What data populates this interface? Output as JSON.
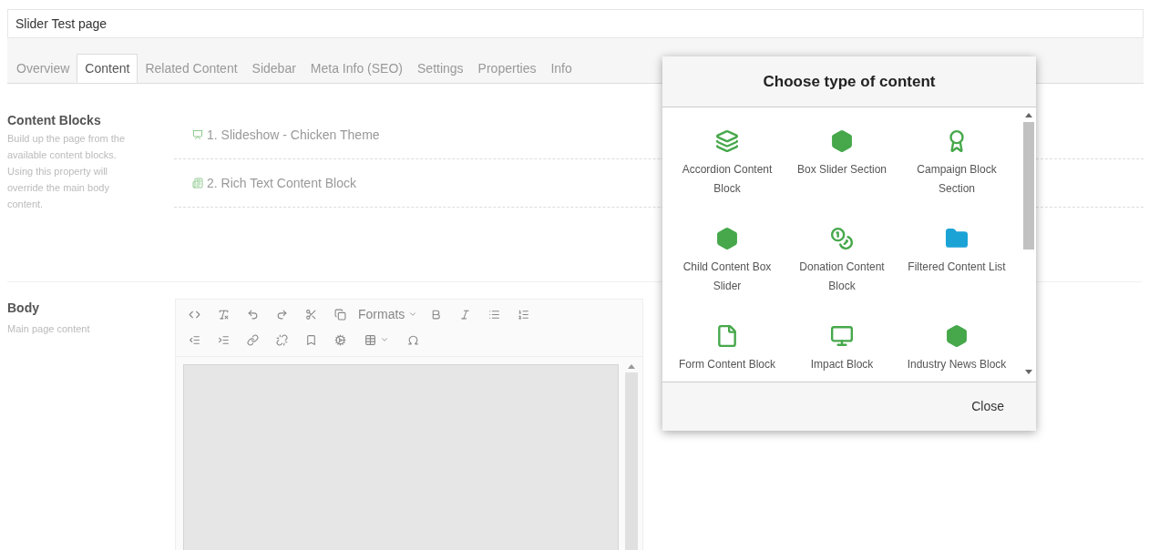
{
  "page_title": "Slider Test page",
  "tabs": [
    {
      "label": "Overview",
      "selected": false
    },
    {
      "label": "Content",
      "selected": true
    },
    {
      "label": "Related Content",
      "selected": false
    },
    {
      "label": "Sidebar",
      "selected": false
    },
    {
      "label": "Meta Info (SEO)",
      "selected": false
    },
    {
      "label": "Settings",
      "selected": false
    },
    {
      "label": "Properties",
      "selected": false
    },
    {
      "label": "Info",
      "selected": false
    }
  ],
  "content_blocks": {
    "label": "Content Blocks",
    "description": "Build up the page from the available content blocks. Using this property will override the main body content.",
    "items": [
      {
        "label": "1. Slideshow - Chicken Theme"
      },
      {
        "label": "2. Rich Text Content Block"
      }
    ]
  },
  "body": {
    "label": "Body",
    "description": "Main page content",
    "toolbar": {
      "formats_label": "Formats"
    }
  },
  "dialog": {
    "title": "Choose type of content",
    "items": [
      {
        "label": "Accordion Content Block"
      },
      {
        "label": "Box Slider Section"
      },
      {
        "label": "Campaign Block Section"
      },
      {
        "label": "Child Content Box Slider"
      },
      {
        "label": "Donation Content Block"
      },
      {
        "label": "Filtered Content List"
      },
      {
        "label": "Form Content Block"
      },
      {
        "label": "Impact Block"
      },
      {
        "label": "Industry News Block"
      }
    ],
    "close_label": "Close"
  }
}
